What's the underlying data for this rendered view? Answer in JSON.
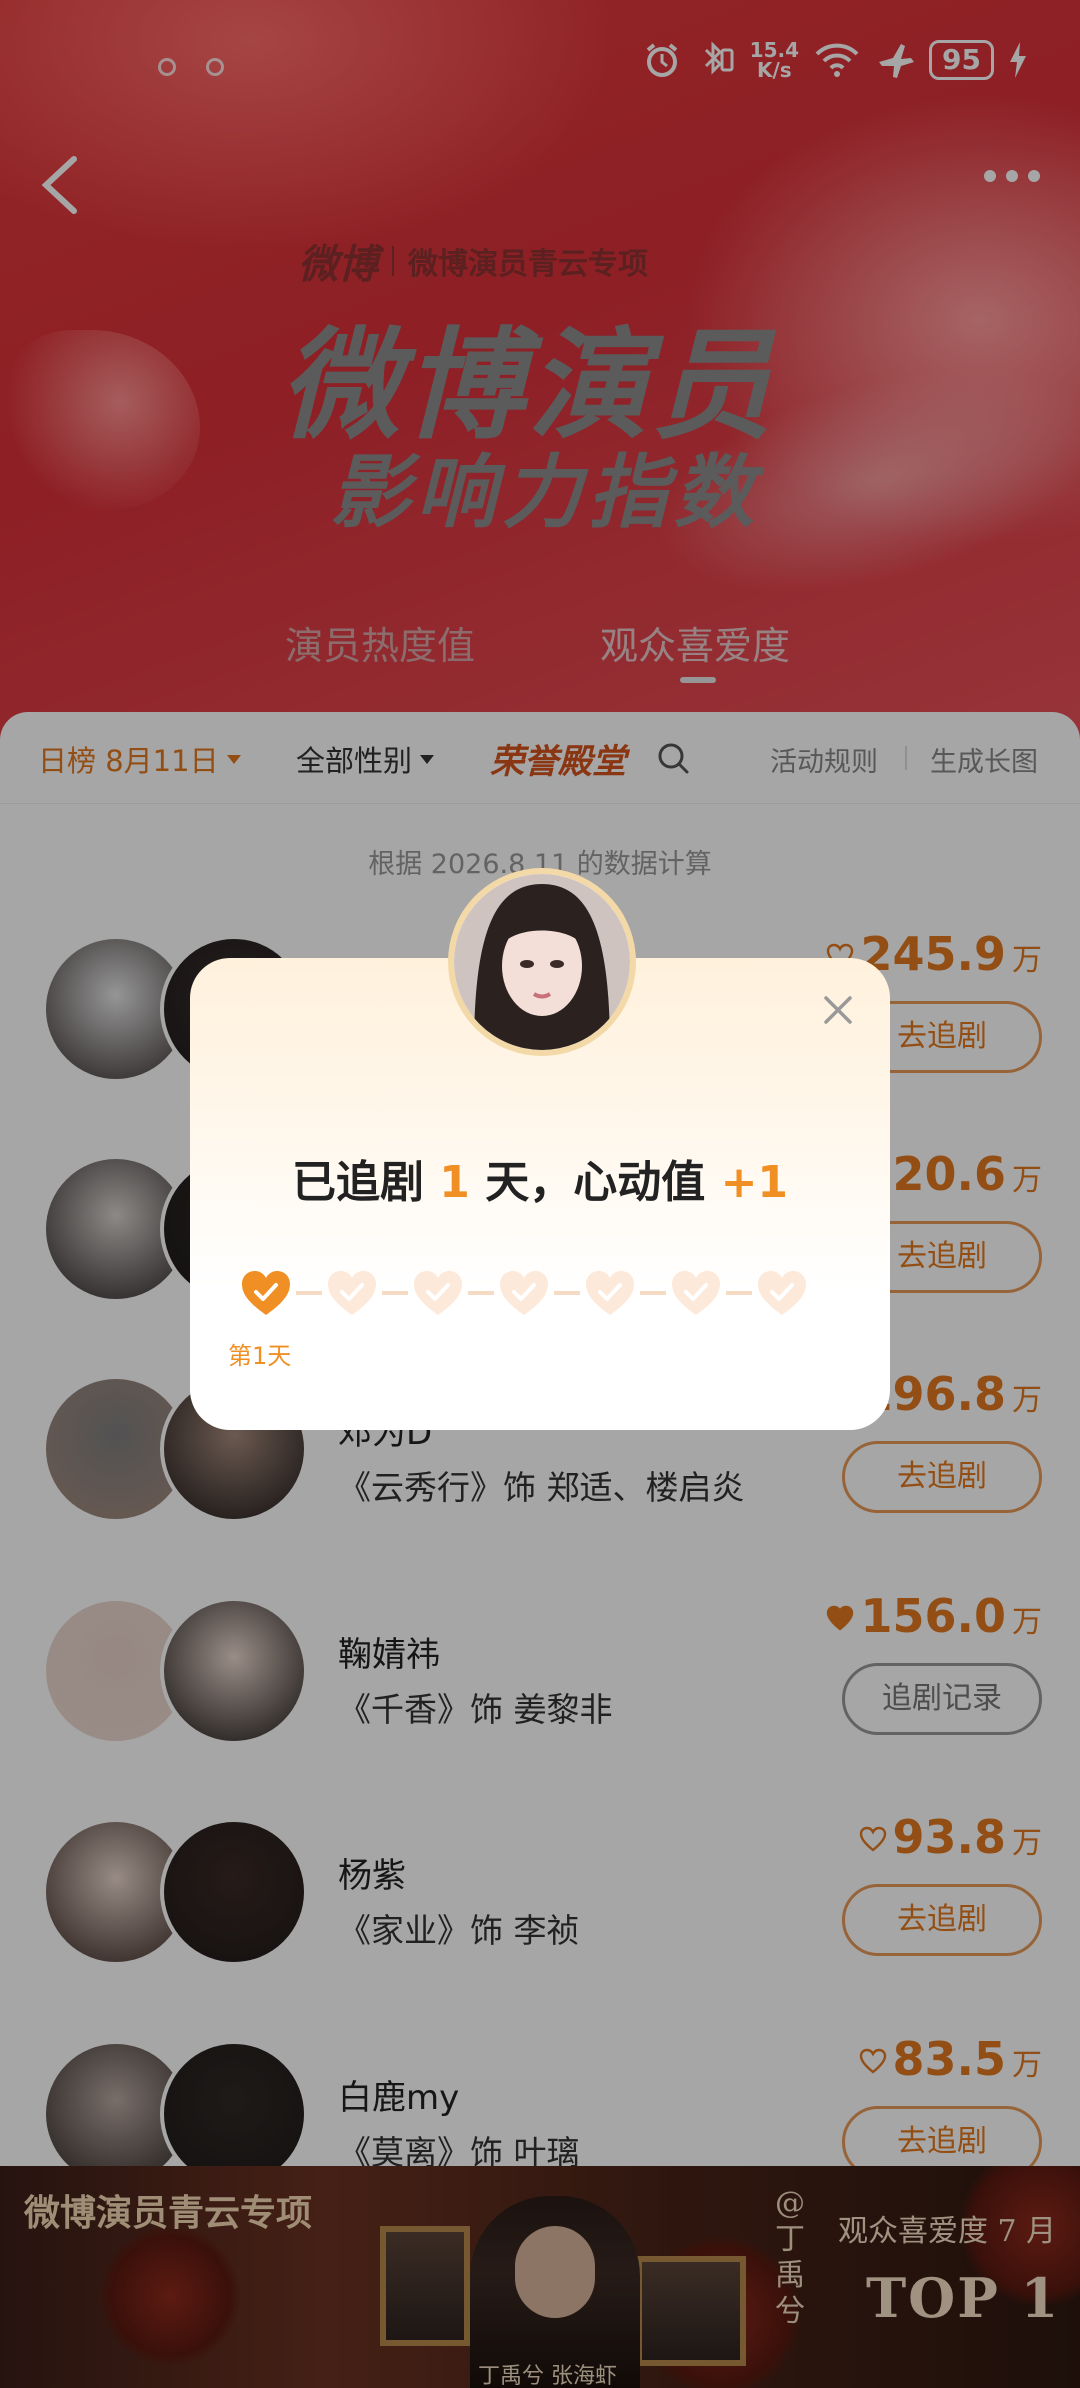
{
  "status_bar": {
    "speed_top": "15.4",
    "speed_unit": "K/s",
    "battery": "95"
  },
  "hero": {
    "brand_logo": "微博",
    "brand_sub": "微博演员青云专项",
    "title_main": "微博演员",
    "title_sub": "影响力指数",
    "tabs": [
      {
        "label": "演员热度值"
      },
      {
        "label": "观众喜爱度"
      }
    ]
  },
  "filters": {
    "date": "日榜 8月11日",
    "gender": "全部性别",
    "honor": "荣誉殿堂",
    "rules": "活动规则",
    "generate": "生成长图"
  },
  "data_note": "根据 2026.8.11 的数据计算",
  "ranking": [
    {
      "name": "",
      "role": "",
      "score": "245.9",
      "unit": "万",
      "button": "去追剧",
      "followed": false
    },
    {
      "name": "",
      "role": "",
      "score": "220.6",
      "unit": "万",
      "button": "去追剧",
      "followed": false
    },
    {
      "name": "邓为D",
      "role": "《云秀行》饰 郑适、楼启炎",
      "score": "196.8",
      "unit": "万",
      "button": "去追剧",
      "followed": false
    },
    {
      "name": "鞠婧祎",
      "role": "《千香》饰 姜黎非",
      "score": "156.0",
      "unit": "万",
      "button": "追剧记录",
      "followed": true
    },
    {
      "name": "杨紫",
      "role": "《家业》饰 李祯",
      "score": "93.8",
      "unit": "万",
      "button": "去追剧",
      "followed": false
    },
    {
      "name": "白鹿my",
      "role": "《莫离》饰 叶璃",
      "score": "83.5",
      "unit": "万",
      "button": "去追剧",
      "followed": false
    }
  ],
  "ad": {
    "left_text": "微博演员青云专项",
    "at_name": "@丁禹兮",
    "names": "丁禹兮 张海虾",
    "right_line1": "观众喜爱度 7 月",
    "right_line2": "TOP 1"
  },
  "dialog": {
    "msg_prefix": "已追剧",
    "days": "1",
    "msg_mid": "天，心动值",
    "plus": "+1",
    "day_label": "第1天",
    "total_days": 7,
    "checked_days": 1
  },
  "colors": {
    "accent": "#f09024",
    "brand_red": "#e23b3b",
    "heart_muted": "#f5dac4"
  }
}
